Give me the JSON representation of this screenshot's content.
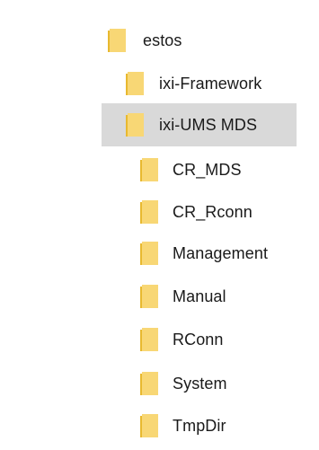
{
  "tree": {
    "items": [
      {
        "label": "estos",
        "icon": "folder-icon",
        "selected": false,
        "depth": 0
      },
      {
        "label": "ixi-Framework",
        "icon": "folder-icon",
        "selected": false,
        "depth": 1
      },
      {
        "label": "ixi-UMS MDS",
        "icon": "folder-icon",
        "selected": true,
        "depth": 1
      },
      {
        "label": "CR_MDS",
        "icon": "folder-icon",
        "selected": false,
        "depth": 2
      },
      {
        "label": "CR_Rconn",
        "icon": "folder-icon",
        "selected": false,
        "depth": 2
      },
      {
        "label": "Management",
        "icon": "folder-icon",
        "selected": false,
        "depth": 2
      },
      {
        "label": "Manual",
        "icon": "folder-icon",
        "selected": false,
        "depth": 2
      },
      {
        "label": "RConn",
        "icon": "folder-icon",
        "selected": false,
        "depth": 2
      },
      {
        "label": "System",
        "icon": "folder-icon",
        "selected": false,
        "depth": 2
      },
      {
        "label": "TmpDir",
        "icon": "folder-icon",
        "selected": false,
        "depth": 2
      }
    ],
    "colors": {
      "folder_front": "#f8d775",
      "folder_back": "#e8b930",
      "selection": "#d9d9d9",
      "text": "#1a1a1a"
    }
  }
}
